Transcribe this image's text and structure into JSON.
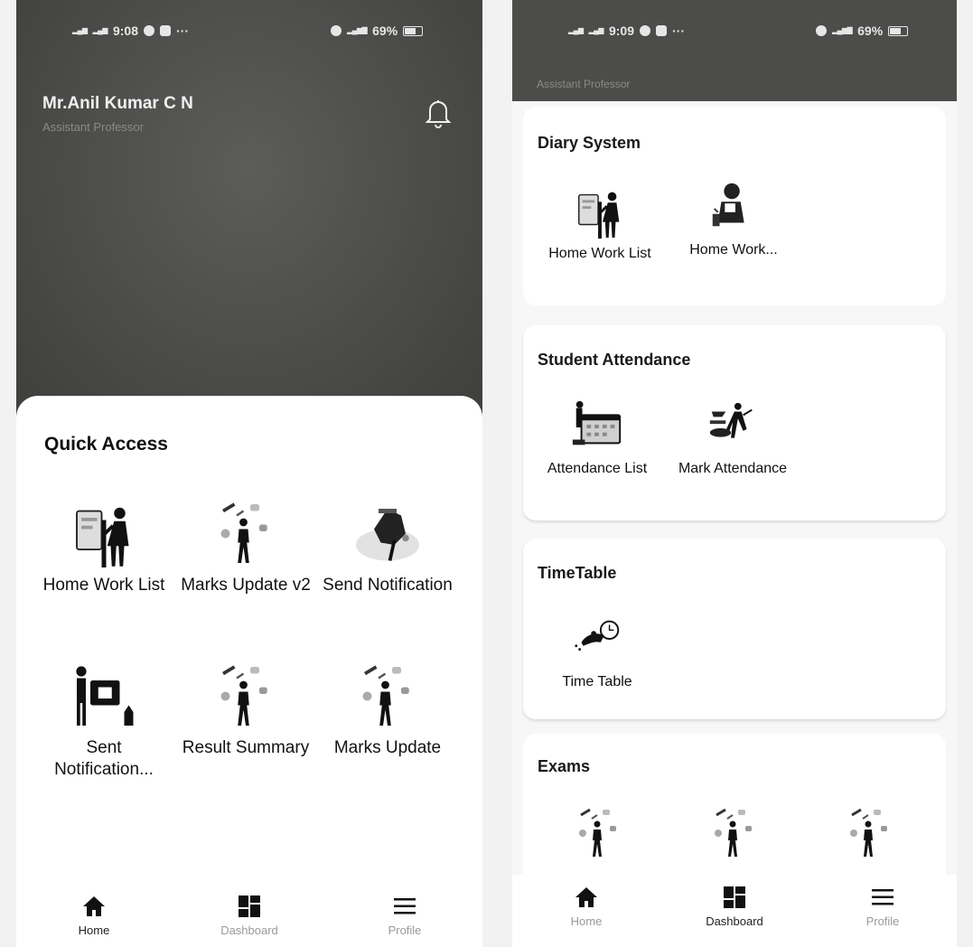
{
  "left": {
    "status": {
      "time": "9:08",
      "battery": "69%"
    },
    "user": {
      "name": "Mr.Anil Kumar C N",
      "role": "Assistant Professor"
    },
    "quick_access": {
      "title": "Quick Access",
      "items": [
        {
          "label": "Home Work List"
        },
        {
          "label": "Marks Update v2"
        },
        {
          "label": "Send Notification"
        },
        {
          "label": "Sent Notification..."
        },
        {
          "label": "Result Summary"
        },
        {
          "label": "Marks Update"
        }
      ]
    },
    "nav": [
      {
        "label": "Home",
        "icon": "home-icon"
      },
      {
        "label": "Dashboard",
        "icon": "dashboard-icon"
      },
      {
        "label": "Profile",
        "icon": "menu-icon"
      }
    ]
  },
  "right": {
    "status": {
      "time": "9:09",
      "battery": "69%"
    },
    "role": "Assistant Professor",
    "sections": {
      "diary": {
        "title": "Diary System",
        "items": [
          {
            "label": "Home Work List"
          },
          {
            "label": "Home Work..."
          }
        ]
      },
      "attendance": {
        "title": "Student Attendance",
        "items": [
          {
            "label": "Attendance List"
          },
          {
            "label": "Mark Attendance"
          }
        ]
      },
      "timetable": {
        "title": "TimeTable",
        "items": [
          {
            "label": "Time Table"
          }
        ]
      },
      "exams": {
        "title": "Exams"
      }
    },
    "nav": [
      {
        "label": "Home",
        "icon": "home-icon"
      },
      {
        "label": "Dashboard",
        "icon": "dashboard-icon"
      },
      {
        "label": "Profile",
        "icon": "menu-icon"
      }
    ]
  },
  "colors": {
    "header_dark": "#4a4a48",
    "text_dark": "#111111",
    "nav_inactive": "#9a9a9a"
  }
}
